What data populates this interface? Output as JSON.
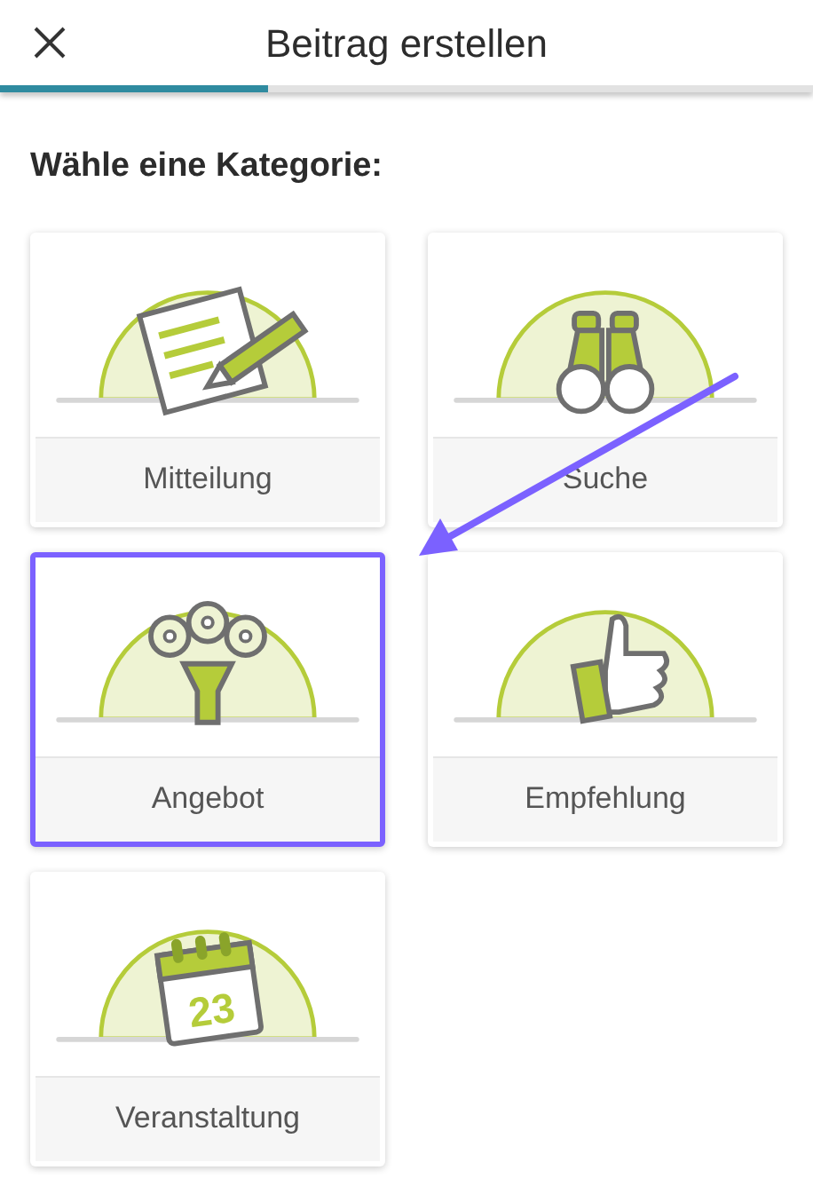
{
  "header": {
    "title": "Beitrag erstellen"
  },
  "progress": {
    "level": 0.33
  },
  "heading": "Wähle eine Kategorie:",
  "categories": [
    {
      "label": "Mitteilung",
      "kind": "note",
      "selected": false
    },
    {
      "label": "Suche",
      "kind": "binoculars",
      "selected": false
    },
    {
      "label": "Angebot",
      "kind": "bouquet",
      "selected": true
    },
    {
      "label": "Empfehlung",
      "kind": "thumb",
      "selected": false
    },
    {
      "label": "Veranstaltung",
      "kind": "calendar",
      "selected": false,
      "day": "23"
    }
  ],
  "annotation": {
    "kind": "arrow"
  }
}
